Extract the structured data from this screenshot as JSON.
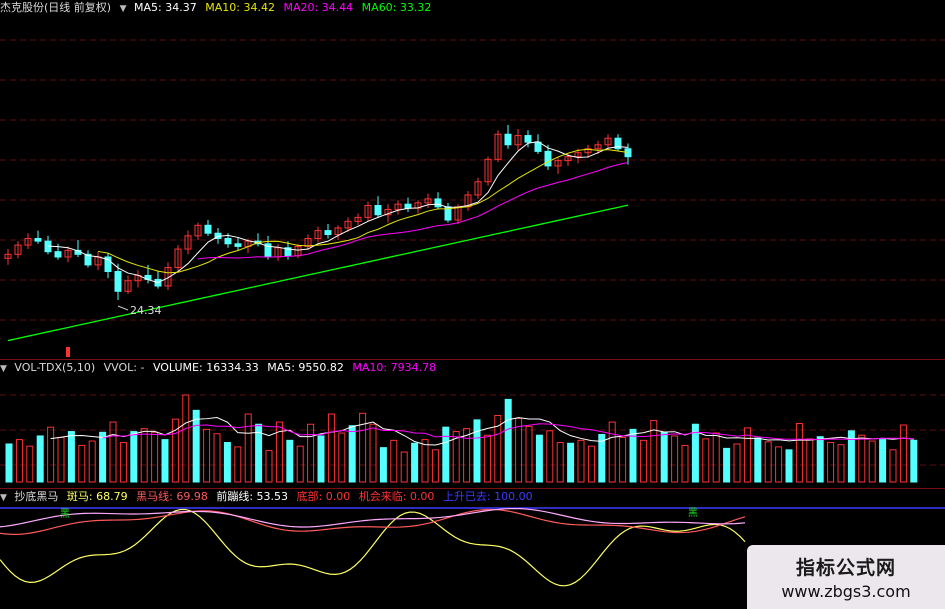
{
  "main_header": {
    "stock_label": "杰克股份(日线 前复权)",
    "ma5": "MA5: 34.37",
    "ma10": "MA10: 34.42",
    "ma20": "MA20: 34.44",
    "ma60": "MA60: 33.32"
  },
  "low_marker": "24.34",
  "volume_header": {
    "name": "VOL-TDX(5,10)",
    "vvol": "VVOL: -",
    "volume": "VOLUME: 16334.33",
    "ma5": "MA5: 9550.82",
    "ma10": "MA10: 7934.78"
  },
  "indicator_header": {
    "name": "抄底黑马",
    "banma": "斑马: 68.79",
    "heima": "黑马线: 69.98",
    "qianbeng": "前蹦线: 53.53",
    "dibu": "底部: 0.00",
    "jihui": "机会来临: 0.00",
    "shangsheng": "上升已去: 100.00"
  },
  "indicator_markers": [
    "黑",
    "黑"
  ],
  "watermark": {
    "title": "指标公式网",
    "url": "www.zbgs3.com"
  },
  "colors": {
    "background": "#000000",
    "candle_up": "#ff3232",
    "candle_down": "#54ffff",
    "ma5_line": "#ffffff",
    "ma10_line": "#e6e600",
    "ma20_line": "#ff00ff",
    "ma60_line": "#00ff00",
    "banma_line": "#ffff66",
    "heima_line": "#ff5a5a",
    "qianbeng_line": "#ffffff",
    "shangsheng_line": "#3c3cff"
  },
  "chart_data": {
    "type": "candlestick",
    "title": "杰克股份(日线 前复权)",
    "min_price_label": 24.34,
    "ohlc": [
      [
        27.5,
        28.2,
        27.0,
        27.8
      ],
      [
        27.8,
        28.8,
        27.5,
        28.5
      ],
      [
        28.5,
        29.4,
        28.2,
        29.0
      ],
      [
        29.0,
        29.6,
        28.6,
        28.8
      ],
      [
        28.8,
        29.2,
        27.8,
        28.0
      ],
      [
        28.0,
        28.6,
        27.4,
        27.6
      ],
      [
        27.6,
        28.4,
        27.2,
        28.1
      ],
      [
        28.1,
        28.9,
        27.6,
        27.8
      ],
      [
        27.8,
        28.1,
        26.8,
        27.0
      ],
      [
        27.0,
        28.0,
        26.6,
        27.6
      ],
      [
        27.6,
        27.9,
        26.0,
        26.5
      ],
      [
        26.5,
        27.1,
        24.34,
        25.0
      ],
      [
        25.0,
        26.2,
        24.8,
        25.8
      ],
      [
        25.8,
        26.6,
        25.3,
        26.2
      ],
      [
        26.2,
        27.0,
        25.6,
        25.9
      ],
      [
        25.9,
        26.5,
        25.2,
        25.4
      ],
      [
        25.4,
        27.2,
        25.1,
        26.8
      ],
      [
        26.8,
        28.5,
        26.5,
        28.2
      ],
      [
        28.2,
        29.6,
        27.8,
        29.2
      ],
      [
        29.2,
        30.2,
        28.9,
        30.0
      ],
      [
        30.0,
        30.4,
        29.2,
        29.4
      ],
      [
        29.4,
        29.8,
        28.6,
        29.0
      ],
      [
        29.0,
        29.4,
        28.3,
        28.6
      ],
      [
        28.6,
        29.1,
        28.1,
        28.4
      ],
      [
        28.4,
        29.0,
        27.9,
        28.8
      ],
      [
        28.8,
        29.4,
        28.4,
        28.6
      ],
      [
        28.6,
        29.2,
        27.4,
        27.6
      ],
      [
        27.6,
        28.6,
        27.3,
        28.3
      ],
      [
        28.3,
        28.8,
        27.4,
        27.7
      ],
      [
        27.7,
        28.6,
        27.5,
        28.4
      ],
      [
        28.4,
        29.3,
        28.1,
        29.0
      ],
      [
        29.0,
        29.9,
        28.7,
        29.6
      ],
      [
        29.6,
        30.1,
        29.0,
        29.3
      ],
      [
        29.3,
        30.0,
        28.9,
        29.8
      ],
      [
        29.8,
        30.6,
        29.5,
        30.3
      ],
      [
        30.3,
        30.9,
        30.0,
        30.6
      ],
      [
        30.6,
        31.8,
        30.3,
        31.5
      ],
      [
        31.5,
        32.2,
        30.6,
        30.8
      ],
      [
        30.8,
        31.6,
        30.2,
        31.2
      ],
      [
        31.2,
        31.9,
        30.8,
        31.6
      ],
      [
        31.6,
        32.1,
        31.0,
        31.3
      ],
      [
        31.3,
        31.9,
        30.9,
        31.7
      ],
      [
        31.7,
        32.4,
        31.3,
        32.0
      ],
      [
        32.0,
        32.5,
        31.2,
        31.4
      ],
      [
        31.4,
        31.7,
        30.2,
        30.4
      ],
      [
        30.4,
        31.6,
        30.1,
        31.4
      ],
      [
        31.4,
        32.6,
        31.1,
        32.3
      ],
      [
        32.3,
        33.6,
        32.0,
        33.3
      ],
      [
        33.3,
        35.2,
        33.0,
        35.0
      ],
      [
        35.0,
        37.2,
        34.8,
        36.9
      ],
      [
        36.9,
        37.6,
        35.8,
        36.1
      ],
      [
        36.1,
        37.3,
        35.7,
        36.8
      ],
      [
        36.8,
        37.2,
        35.9,
        36.3
      ],
      [
        36.3,
        36.9,
        35.4,
        35.6
      ],
      [
        35.6,
        36.1,
        34.2,
        34.5
      ],
      [
        34.5,
        35.2,
        33.9,
        34.9
      ],
      [
        34.9,
        35.4,
        34.5,
        35.2
      ],
      [
        35.2,
        35.8,
        34.7,
        35.5
      ],
      [
        35.5,
        36.1,
        35.1,
        35.8
      ],
      [
        35.8,
        36.4,
        35.4,
        36.1
      ],
      [
        36.1,
        36.9,
        35.8,
        36.6
      ],
      [
        36.6,
        36.9,
        35.6,
        35.8
      ],
      [
        35.8,
        36.2,
        34.6,
        35.2
      ]
    ],
    "volume": [
      5200,
      5800,
      4900,
      6300,
      7500,
      6100,
      6900,
      5000,
      5600,
      6800,
      8200,
      5400,
      6900,
      7300,
      6800,
      5800,
      8600,
      11900,
      9800,
      7200,
      6600,
      5400,
      4800,
      9300,
      7900,
      4300,
      8200,
      5700,
      4900,
      7900,
      6300,
      9300,
      6700,
      7700,
      9400,
      7900,
      4700,
      5700,
      4100,
      5300,
      5800,
      4400,
      7500,
      6900,
      7300,
      8500,
      6400,
      9100,
      11300,
      8700,
      7600,
      6400,
      7000,
      5400,
      5300,
      5700,
      4900,
      6500,
      8200,
      6100,
      7200,
      5700,
      8400,
      6800,
      6300,
      5000,
      7900,
      5900,
      6700,
      4600,
      5200,
      7400,
      6000,
      5500,
      4800,
      4400,
      8000,
      5900,
      6200,
      5400,
      5100,
      7000,
      6400,
      5600,
      5800,
      4400,
      7800,
      5700
    ],
    "indicator": {
      "banma": [
        68.79
      ],
      "heima": [
        69.98
      ],
      "qianbeng": [
        53.53
      ],
      "dibu": [
        0.0
      ],
      "jihui": [
        0.0
      ],
      "shangsheng": [
        100.0
      ]
    }
  }
}
